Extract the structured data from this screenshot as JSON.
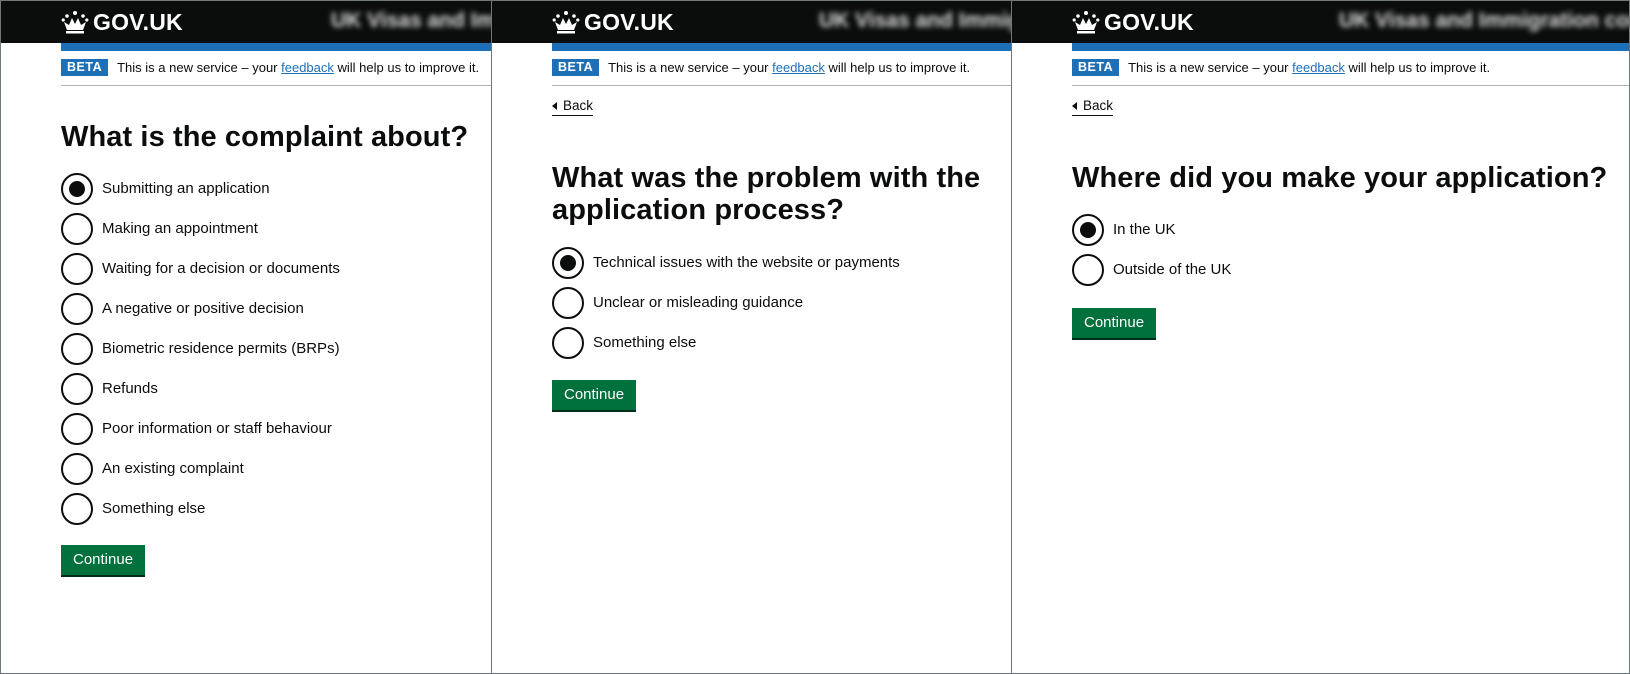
{
  "header": {
    "logotype": "GOV.UK",
    "crown_icon": "crown-icon",
    "service_names": [
      "UK Visas and Immigration complaints",
      "UK Visas and Immigration complaints",
      "UK Visas and Immigration complaints"
    ]
  },
  "phase": {
    "tag": "BETA",
    "text_before": "This is a new service – your ",
    "link": "feedback",
    "text_after": " will help us to improve it."
  },
  "back_label": "Back",
  "continue_label": "Continue",
  "colors": {
    "header_bg": "#0b0c0c",
    "brand_blue": "#1d70b8",
    "button_green": "#00703c",
    "text": "#0b0c0c"
  },
  "screens": [
    {
      "heading": "What is the complaint about?",
      "options": [
        {
          "label": "Submitting an application",
          "checked": true
        },
        {
          "label": "Making an appointment",
          "checked": false
        },
        {
          "label": "Waiting for a decision or documents",
          "checked": false
        },
        {
          "label": "A negative or positive decision",
          "checked": false
        },
        {
          "label": "Biometric residence permits (BRPs)",
          "checked": false
        },
        {
          "label": "Refunds",
          "checked": false
        },
        {
          "label": "Poor information or staff behaviour",
          "checked": false
        },
        {
          "label": "An existing complaint",
          "checked": false
        },
        {
          "label": "Something else",
          "checked": false
        }
      ]
    },
    {
      "heading": "What was the problem with the application process?",
      "options": [
        {
          "label": "Technical issues with the website or payments",
          "checked": true
        },
        {
          "label": "Unclear or misleading guidance",
          "checked": false
        },
        {
          "label": "Something else",
          "checked": false
        }
      ]
    },
    {
      "heading": "Where did you make your application?",
      "options": [
        {
          "label": "In the UK",
          "checked": true
        },
        {
          "label": "Outside of the UK",
          "checked": false
        }
      ]
    }
  ]
}
